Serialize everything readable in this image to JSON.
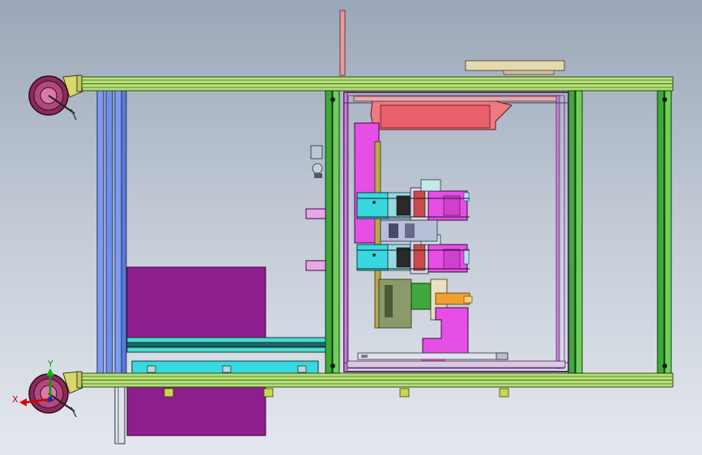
{
  "triad": {
    "x_label": "X",
    "y_label": "Y",
    "x_color": "#d10000",
    "y_color": "#00a000"
  },
  "colors": {
    "frame_green": "#b8e07a",
    "frame_green_dark": "#2f6b1e",
    "post_green": "#3fa83a",
    "blue_rail": "#6f8fe8",
    "purple_panel": "#8e1d8e",
    "cyan": "#38d8e0",
    "magenta": "#e64fe6",
    "pink": "#f07a82",
    "tan": "#e6d9b0",
    "yellow_green": "#c8d84a",
    "caster_wheel": "#8a2a5a"
  }
}
